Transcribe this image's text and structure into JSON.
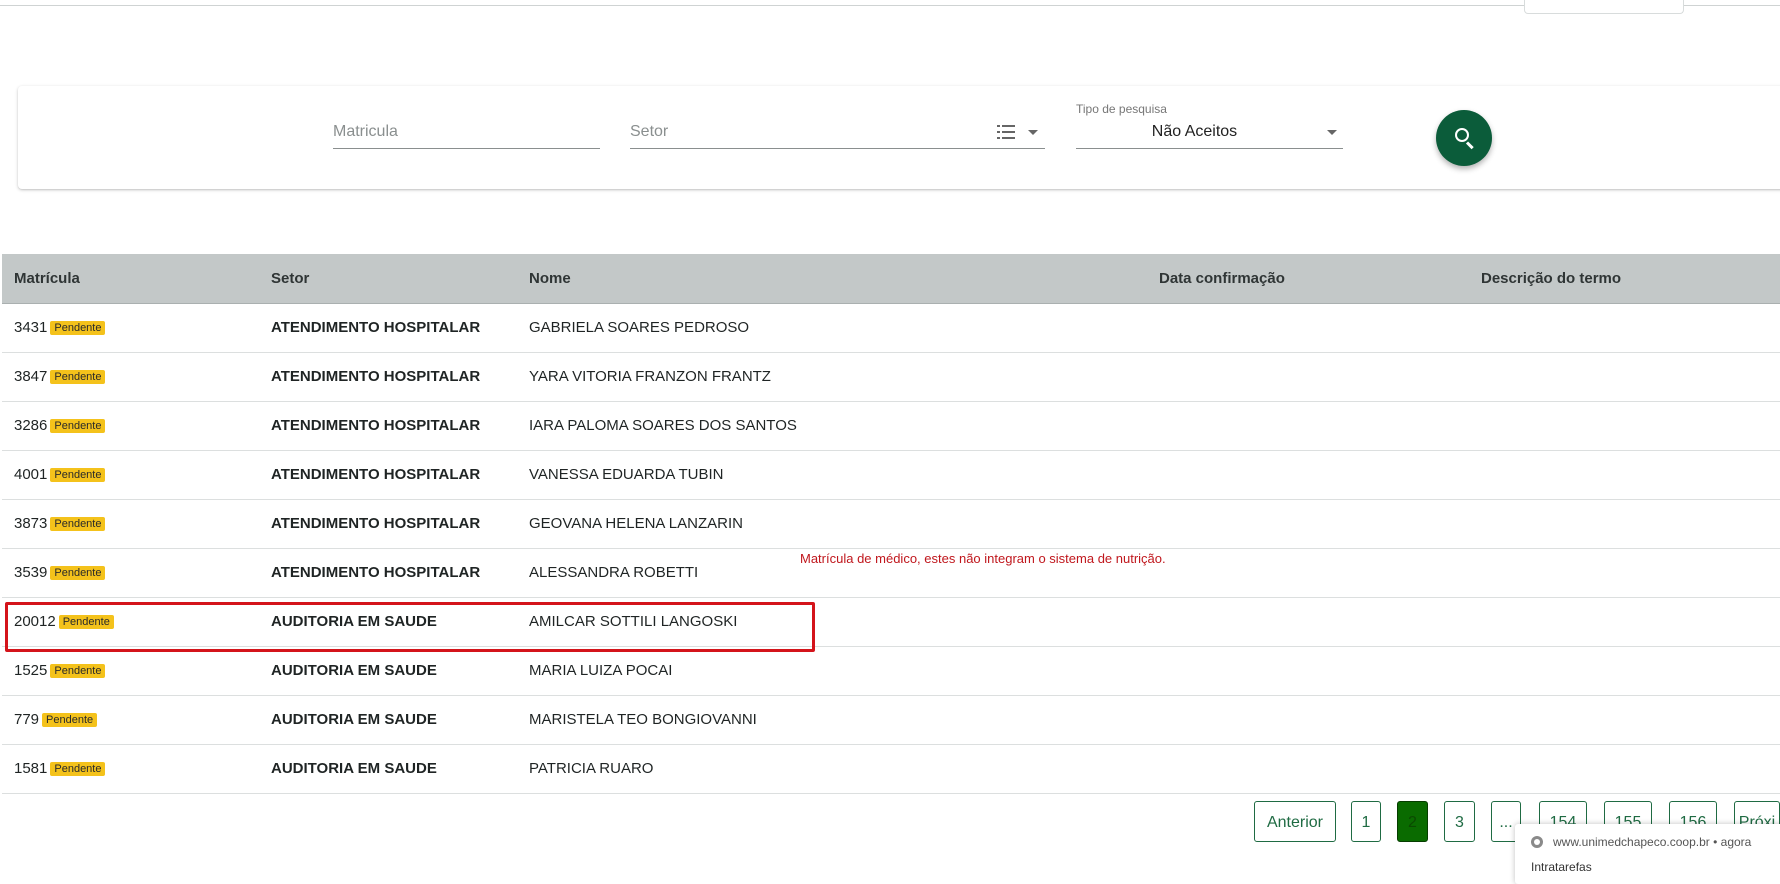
{
  "filters": {
    "matricula_placeholder": "Matricula",
    "setor_placeholder": "Setor",
    "tipo_label": "Tipo de pesquisa",
    "tipo_value": "Não Aceitos",
    "search_icon": "search-icon"
  },
  "table": {
    "headers": [
      "Matrícula",
      "Setor",
      "Nome",
      "Data confirmação",
      "Descrição do termo"
    ],
    "rows": [
      {
        "matricula": "3431",
        "status": "Pendente",
        "setor": "ATENDIMENTO HOSPITALAR",
        "nome": "GABRIELA SOARES PEDROSO"
      },
      {
        "matricula": "3847",
        "status": "Pendente",
        "setor": "ATENDIMENTO HOSPITALAR",
        "nome": "YARA VITORIA FRANZON FRANTZ"
      },
      {
        "matricula": "3286",
        "status": "Pendente",
        "setor": "ATENDIMENTO HOSPITALAR",
        "nome": "IARA PALOMA SOARES DOS SANTOS"
      },
      {
        "matricula": "4001",
        "status": "Pendente",
        "setor": "ATENDIMENTO HOSPITALAR",
        "nome": "VANESSA EDUARDA TUBIN"
      },
      {
        "matricula": "3873",
        "status": "Pendente",
        "setor": "ATENDIMENTO HOSPITALAR",
        "nome": "GEOVANA HELENA LANZARIN"
      },
      {
        "matricula": "3539",
        "status": "Pendente",
        "setor": "ATENDIMENTO HOSPITALAR",
        "nome": "ALESSANDRA ROBETTI"
      },
      {
        "matricula": "20012",
        "status": "Pendente",
        "setor": "AUDITORIA EM SAUDE",
        "nome": "AMILCAR SOTTILI LANGOSKI"
      },
      {
        "matricula": "1525",
        "status": "Pendente",
        "setor": "AUDITORIA EM SAUDE",
        "nome": "MARIA LUIZA POCAI"
      },
      {
        "matricula": "779",
        "status": "Pendente",
        "setor": "AUDITORIA EM SAUDE",
        "nome": "MARISTELA TEO BONGIOVANNI"
      },
      {
        "matricula": "1581",
        "status": "Pendente",
        "setor": "AUDITORIA EM SAUDE",
        "nome": "PATRICIA RUARO"
      }
    ]
  },
  "annotation": {
    "text": "Matrícula de médico, estes não integram o sistema de nutrição."
  },
  "pagination": {
    "prev": "Anterior",
    "pages": [
      "1",
      "2",
      "3",
      "...",
      "154",
      "155",
      "156"
    ],
    "current": "2",
    "next": "Próxi"
  },
  "notification": {
    "source": "www.unimedchapeco.coop.br",
    "time": "agora",
    "title": "Intratarefas"
  },
  "colors": {
    "primary": "#0b5c3a",
    "badge": "#f4c21b",
    "header_bg": "#c3c8c8",
    "annotation": "#c0171d",
    "active_page": "#0a6b00"
  }
}
